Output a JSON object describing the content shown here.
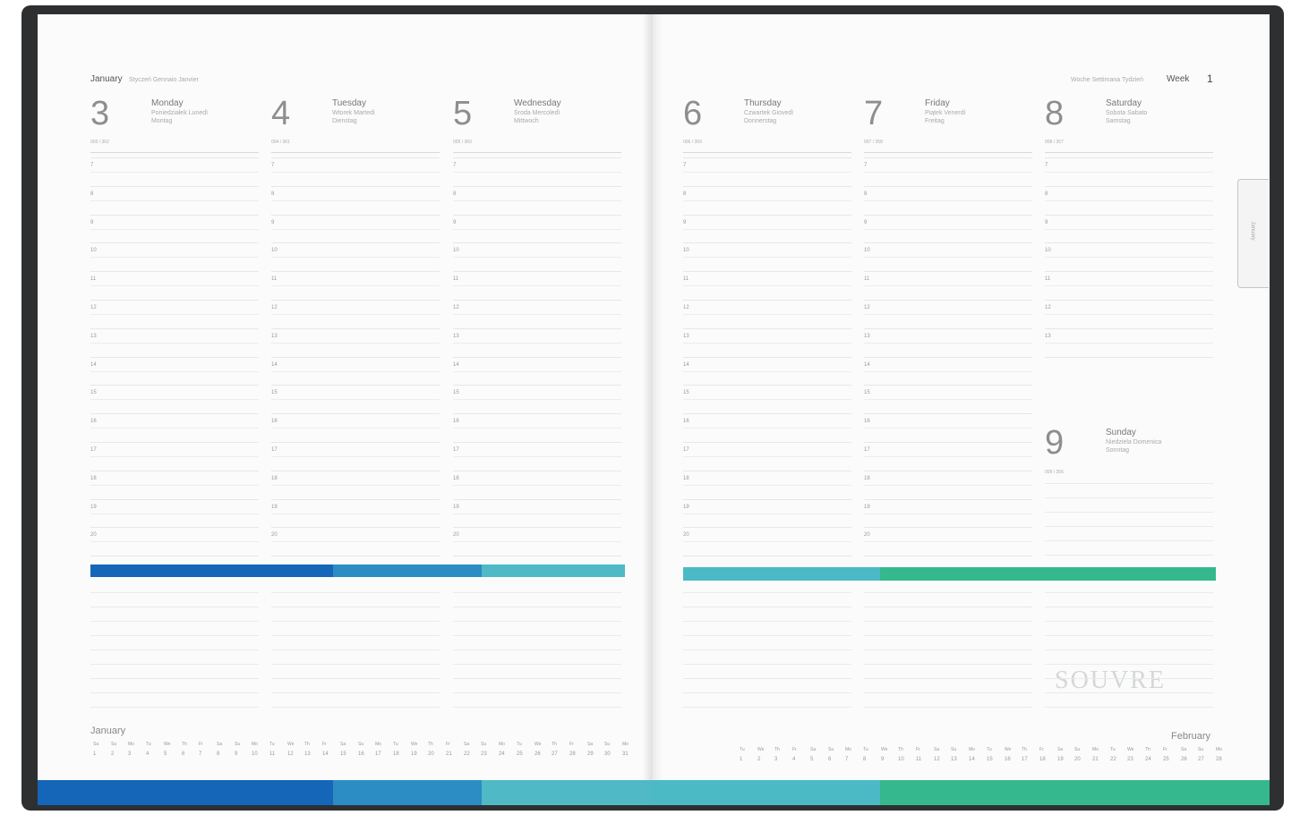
{
  "left_page": {
    "header_month": "January",
    "header_translations": "Styczeń Gennaio Janvier",
    "days": [
      {
        "number": "3",
        "name": "Monday",
        "translations": [
          "Poniedziałek Lunedì",
          "Montag"
        ],
        "day_of_year": "003 / 362"
      },
      {
        "number": "4",
        "name": "Tuesday",
        "translations": [
          "Wtorek Martedì",
          "Dienstag"
        ],
        "day_of_year": "004 / 361"
      },
      {
        "number": "5",
        "name": "Wednesday",
        "translations": [
          "Środa Mercoledì",
          "Mittwoch"
        ],
        "day_of_year": "005 / 360"
      }
    ]
  },
  "right_page": {
    "header_translations": "Woche Settimana Tydzień",
    "header_week_label": "Week",
    "week_number": "1",
    "days": [
      {
        "number": "6",
        "name": "Thursday",
        "translations": [
          "Czwartek Giovedì",
          "Donnerstag"
        ],
        "day_of_year": "006 / 359"
      },
      {
        "number": "7",
        "name": "Friday",
        "translations": [
          "Piątek Venerdì",
          "Freitag"
        ],
        "day_of_year": "007 / 358"
      },
      {
        "number": "8",
        "name": "Saturday",
        "translations": [
          "Sobota Sabato",
          "Samstag"
        ],
        "day_of_year": "008 / 357"
      },
      {
        "number": "9",
        "name": "Sunday",
        "translations": [
          "Niedziela Domenica",
          "Sonntag"
        ],
        "day_of_year": "009 / 356"
      }
    ],
    "tab_label": "January",
    "logo": "SOUVRE"
  },
  "hours": [
    "7",
    "8",
    "9",
    "10",
    "11",
    "12",
    "13",
    "14",
    "15",
    "16",
    "17",
    "18",
    "19",
    "20"
  ],
  "mini_calendars": [
    {
      "month": "January",
      "day_names": [
        "Sa",
        "Su",
        "Mo",
        "Tu",
        "We",
        "Th",
        "Fr",
        "Sa",
        "Su",
        "Mo",
        "Tu",
        "We",
        "Th",
        "Fr",
        "Sa",
        "Su",
        "Mo",
        "Tu",
        "We",
        "Th",
        "Fr",
        "Sa",
        "Su",
        "Mo",
        "Tu",
        "We",
        "Th",
        "Fr",
        "Sa",
        "Su",
        "Mo"
      ],
      "dates": [
        "1",
        "2",
        "3",
        "4",
        "5",
        "6",
        "7",
        "8",
        "9",
        "10",
        "11",
        "12",
        "13",
        "14",
        "15",
        "16",
        "17",
        "18",
        "19",
        "20",
        "21",
        "22",
        "23",
        "24",
        "25",
        "26",
        "27",
        "28",
        "29",
        "30",
        "31"
      ]
    },
    {
      "month": "February",
      "day_names": [
        "Tu",
        "We",
        "Th",
        "Fr",
        "Sa",
        "Su",
        "Mo",
        "Tu",
        "We",
        "Th",
        "Fr",
        "Sa",
        "Su",
        "Mo",
        "Tu",
        "We",
        "Th",
        "Fr",
        "Sa",
        "Su",
        "Mo",
        "Tu",
        "We",
        "Th",
        "Fr",
        "Sa",
        "Su",
        "Mo"
      ],
      "dates": [
        "1",
        "2",
        "3",
        "4",
        "5",
        "6",
        "7",
        "8",
        "9",
        "10",
        "11",
        "12",
        "13",
        "14",
        "15",
        "16",
        "17",
        "18",
        "19",
        "20",
        "21",
        "22",
        "23",
        "24",
        "25",
        "26",
        "27",
        "28"
      ]
    }
  ],
  "colors": {
    "cover": "#2e2f31",
    "page": "#fbfbfb",
    "band_left": [
      "#1565b8",
      "#2b8dc4",
      "#4fb9c5"
    ],
    "band_right": [
      "#4bbac5",
      "#35b88e"
    ]
  }
}
